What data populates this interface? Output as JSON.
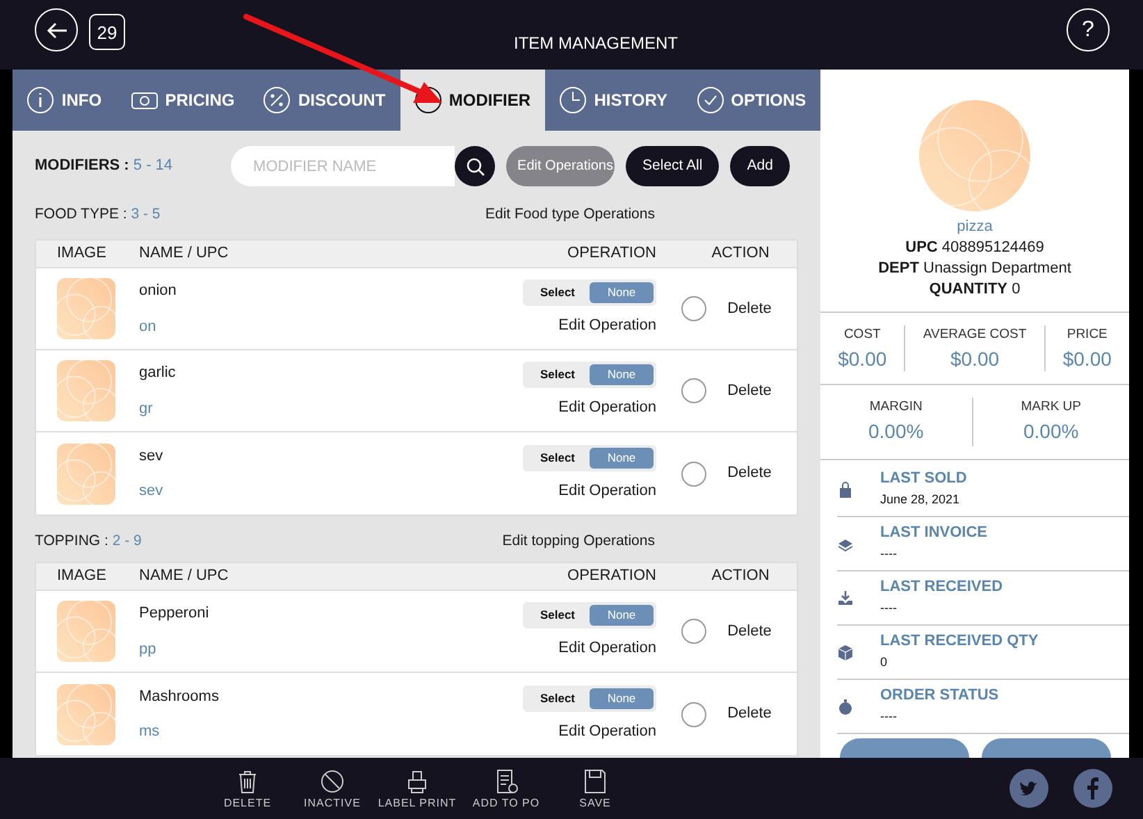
{
  "header": {
    "title": "ITEM MANAGEMENT",
    "calendar_day": "29",
    "help": "?"
  },
  "tabs": [
    {
      "label": "INFO",
      "selected": false
    },
    {
      "label": "PRICING",
      "selected": false
    },
    {
      "label": "DISCOUNT",
      "selected": false
    },
    {
      "label": "MODIFIER",
      "selected": true
    },
    {
      "label": "HISTORY",
      "selected": false
    },
    {
      "label": "OPTIONS",
      "selected": false
    }
  ],
  "modifiers": {
    "label": "MODIFIERS :",
    "range": "5 - 14",
    "search_placeholder": "MODIFIER NAME",
    "buttons": [
      {
        "label": "Edit Operations",
        "kind": "muted"
      },
      {
        "label": "Select All",
        "kind": "dark"
      },
      {
        "label": "Add",
        "kind": "dark"
      }
    ]
  },
  "groups": [
    {
      "label": "FOOD TYPE :",
      "range": "3 - 5",
      "edit_link": "Edit Food type Operations",
      "columns": [
        "IMAGE",
        "NAME / UPC",
        "OPERATION",
        "ACTION"
      ],
      "rows": [
        {
          "name": "onion",
          "upc": "on",
          "options": [
            {
              "label": "Select",
              "selected": false
            },
            {
              "label": "None",
              "selected": true
            }
          ],
          "edit": "Edit Operation",
          "checked": false,
          "action": "Delete"
        },
        {
          "name": "garlic",
          "upc": "gr",
          "options": [
            {
              "label": "Select",
              "selected": false
            },
            {
              "label": "None",
              "selected": true
            }
          ],
          "edit": "Edit Operation",
          "checked": false,
          "action": "Delete"
        },
        {
          "name": "sev",
          "upc": "sev",
          "options": [
            {
              "label": "Select",
              "selected": false
            },
            {
              "label": "None",
              "selected": true
            }
          ],
          "edit": "Edit Operation",
          "checked": false,
          "action": "Delete"
        }
      ]
    },
    {
      "label": "TOPPING :",
      "range": "2 - 9",
      "edit_link": "Edit topping Operations",
      "columns": [
        "IMAGE",
        "NAME / UPC",
        "OPERATION",
        "ACTION"
      ],
      "rows": [
        {
          "name": "Pepperoni",
          "upc": "pp",
          "options": [
            {
              "label": "Select",
              "selected": false
            },
            {
              "label": "None",
              "selected": true
            }
          ],
          "edit": "Edit Operation",
          "checked": false,
          "action": "Delete"
        },
        {
          "name": "Mashrooms",
          "upc": "ms",
          "options": [
            {
              "label": "Select",
              "selected": false
            },
            {
              "label": "None",
              "selected": true
            }
          ],
          "edit": "Edit Operation",
          "checked": false,
          "action": "Delete"
        }
      ]
    }
  ],
  "product": {
    "name": "pizza",
    "upc_label": "UPC",
    "upc": "408895124469",
    "dept_label": "DEPT",
    "dept": "Unassign Department",
    "qty_label": "QUANTITY",
    "qty": "0"
  },
  "costs": [
    {
      "label": "COST",
      "value": "$0.00"
    },
    {
      "label": "AVERAGE COST",
      "value": "$0.00"
    },
    {
      "label": "PRICE",
      "value": "$0.00"
    }
  ],
  "margins": [
    {
      "label": "MARGIN",
      "value": "0.00%"
    },
    {
      "label": "MARK UP",
      "value": "0.00%"
    }
  ],
  "history": [
    {
      "label": "LAST SOLD",
      "value": "June 28, 2021"
    },
    {
      "label": "LAST INVOICE",
      "value": "----"
    },
    {
      "label": "LAST RECEIVED",
      "value": "----"
    },
    {
      "label": "LAST RECEIVED QTY",
      "value": "0"
    },
    {
      "label": "ORDER STATUS",
      "value": "----"
    }
  ],
  "bottom_actions": [
    "DELETE",
    "INACTIVE",
    "LABEL PRINT",
    "ADD TO PO",
    "SAVE"
  ]
}
